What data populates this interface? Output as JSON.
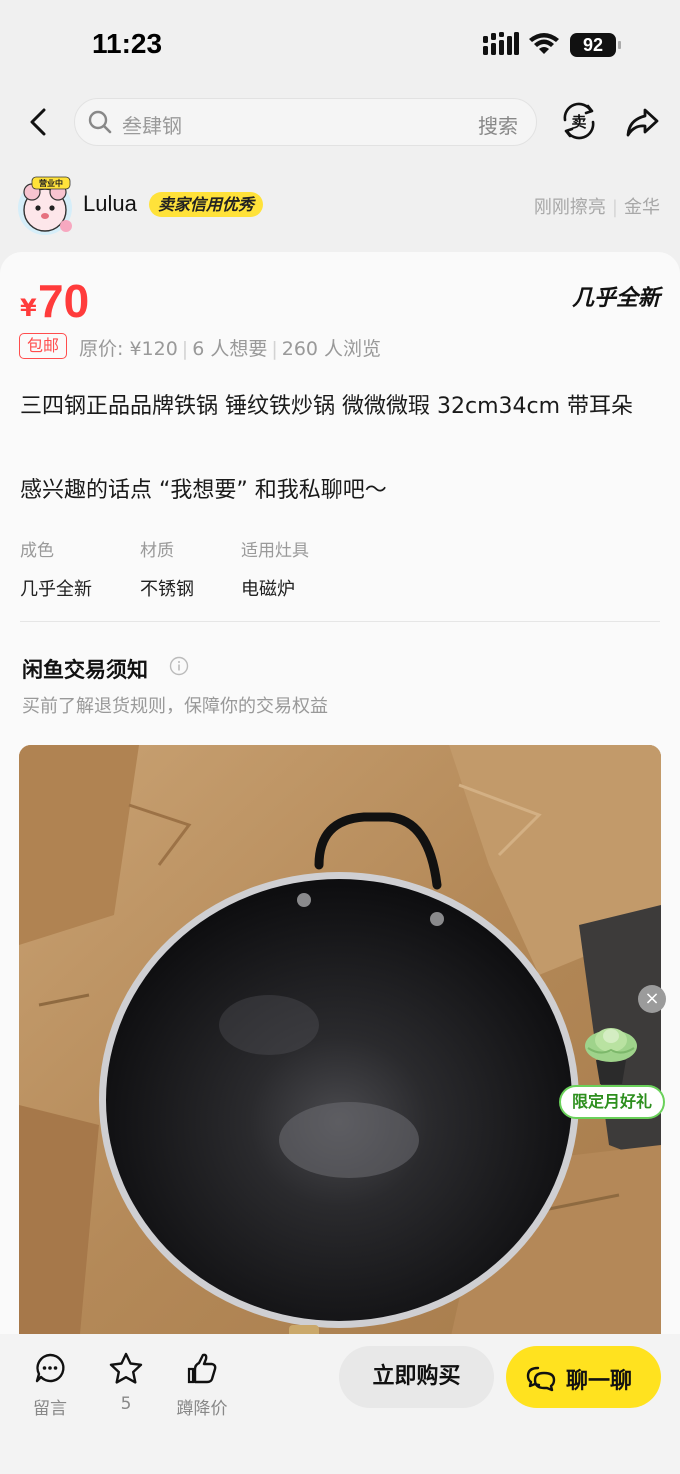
{
  "status_bar": {
    "time": "11:23",
    "battery": "92"
  },
  "search": {
    "placeholder": "叁肆钢",
    "button": "搜索"
  },
  "seller": {
    "name": "Lulua",
    "credit_badge": "卖家信用优秀",
    "polished": "刚刚擦亮",
    "location": "金华",
    "avatar_tag": "营业中"
  },
  "product": {
    "currency": "¥",
    "price": "70",
    "condition_badge": "几乎全新",
    "free_shipping": "包邮",
    "original_price": "原价: ¥120",
    "wants": "6 人想要",
    "views": "260 人浏览",
    "title": "三四钢正品品牌铁锅  锤纹铁炒锅 微微微瑕 32cm34cm 带耳朵",
    "description": "感兴趣的话点 “我想要” 和我私聊吧～",
    "attributes": [
      {
        "key": "成色",
        "value": "几乎全新"
      },
      {
        "key": "材质",
        "value": "不锈钢"
      },
      {
        "key": "适用灶具",
        "value": "电磁炉"
      }
    ]
  },
  "notice": {
    "title": "闲鱼交易须知",
    "subtitle": "买前了解退货规则，保障你的交易权益"
  },
  "promo": {
    "label": "限定月好礼",
    "close": "×"
  },
  "bottom_bar": {
    "comment": "留言",
    "favorites": "5",
    "price_drop": "蹲降价",
    "buy": "立即购买",
    "chat": "聊一聊"
  }
}
